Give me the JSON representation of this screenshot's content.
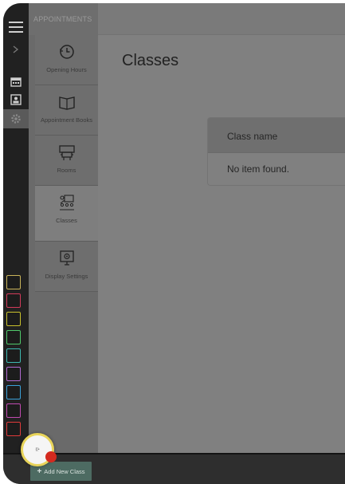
{
  "section": {
    "title": "APPOINTMENTS"
  },
  "subnav": {
    "items": [
      {
        "label": "Opening Hours",
        "icon": "clock-icon"
      },
      {
        "label": "Appointment Books",
        "icon": "book-icon"
      },
      {
        "label": "Rooms",
        "icon": "room-icon"
      },
      {
        "label": "Classes",
        "icon": "class-icon",
        "active": true
      },
      {
        "label": "Display Settings",
        "icon": "display-icon"
      }
    ]
  },
  "main": {
    "title": "Classes",
    "table": {
      "columns": [
        "Class name"
      ],
      "empty_text": "No item found."
    }
  },
  "footer": {
    "add_button": "Add New Class",
    "add_icon": "+"
  },
  "assist": {
    "text": "((•"
  },
  "rail": {
    "apps": [
      {
        "name": "calendar-app-icon",
        "color": "#c9b35a"
      },
      {
        "name": "agenda-app-icon",
        "color": "#d23a5a"
      },
      {
        "name": "grid-app-icon",
        "color": "#c8c02c"
      },
      {
        "name": "bag-app-icon",
        "color": "#4fc86a"
      },
      {
        "name": "report-app-icon",
        "color": "#3db8b0"
      },
      {
        "name": "chat-app-icon",
        "color": "#b06ad0"
      },
      {
        "name": "document-app-icon",
        "color": "#3aa0d8"
      },
      {
        "name": "list-app-icon",
        "color": "#c04ab0"
      },
      {
        "name": "scissors-app-icon",
        "color": "#e03a3a"
      }
    ]
  }
}
